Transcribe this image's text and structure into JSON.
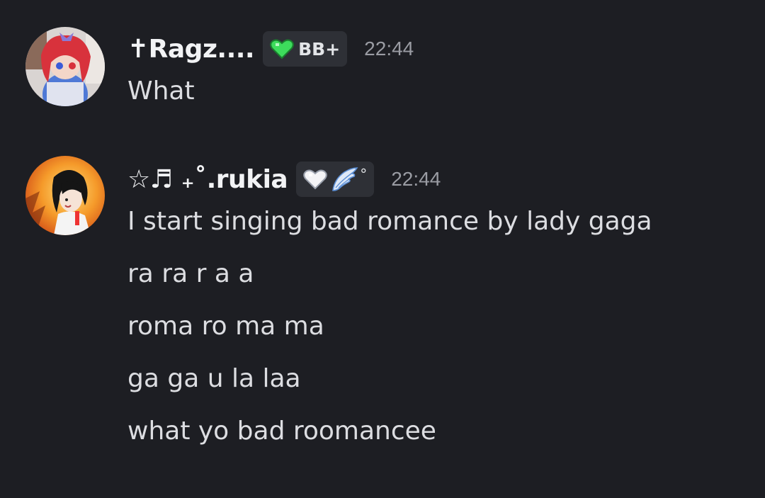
{
  "messages": [
    {
      "username": "✝Ragz....",
      "tag": {
        "icon": "green-heart-icon",
        "label": "BB+"
      },
      "timestamp": "22:44",
      "lines": [
        "What"
      ]
    },
    {
      "username": "☆♬ ₊˚.rukia",
      "tag": {
        "icons": [
          "white-heart-icon",
          "angel-wing-icon"
        ],
        "suffix": "°"
      },
      "timestamp": "22:44",
      "lines": [
        "I start singing bad romance by lady gaga",
        "ra ra r a a",
        "roma ro ma ma",
        "ga ga u la laa",
        "what yo bad roomancee"
      ]
    }
  ],
  "colors": {
    "background": "#1d1e23",
    "username": "#f2f3f5",
    "message_text": "#dcdde1",
    "timestamp": "#9a9ca3",
    "tag_background": "#2e3036",
    "green_heart": "#3ddc5c"
  }
}
